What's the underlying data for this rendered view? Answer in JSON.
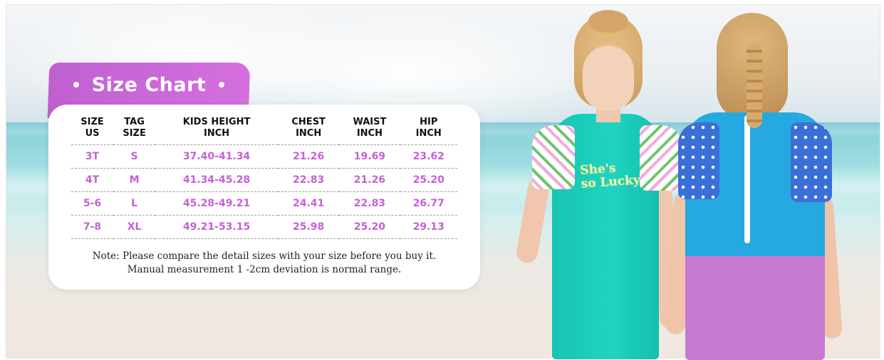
{
  "title": "Size Chart",
  "table": {
    "headers": [
      "SIZE\nUS",
      "TAG\nSIZE",
      "KIDS HEIGHT\nINCH",
      "CHEST\nINCH",
      "WAIST\nINCH",
      "HIP\nINCH"
    ],
    "rows": [
      [
        "3T",
        "S",
        "37.40-41.34",
        "21.26",
        "19.69",
        "23.62"
      ],
      [
        "4T",
        "M",
        "41.34-45.28",
        "22.83",
        "21.26",
        "25.20"
      ],
      [
        "5-6",
        "L",
        "45.28-49.21",
        "24.41",
        "22.83",
        "26.77"
      ],
      [
        "7-8",
        "XL",
        "49.21-53.15",
        "25.98",
        "25.20",
        "29.13"
      ]
    ]
  },
  "note": {
    "line1": "Note: Please compare the detail sizes with your size before you buy it.",
    "line2": "Manual measurement 1 -2cm deviation is normal range."
  },
  "swimsuit_print": {
    "line1": "She's",
    "line2": "so Lucky"
  },
  "colors": {
    "accent": "#c560d6",
    "suit_teal": "#1fd3c2",
    "suit_blue": "#26a8e0",
    "suit_purple": "#c77ad2"
  }
}
